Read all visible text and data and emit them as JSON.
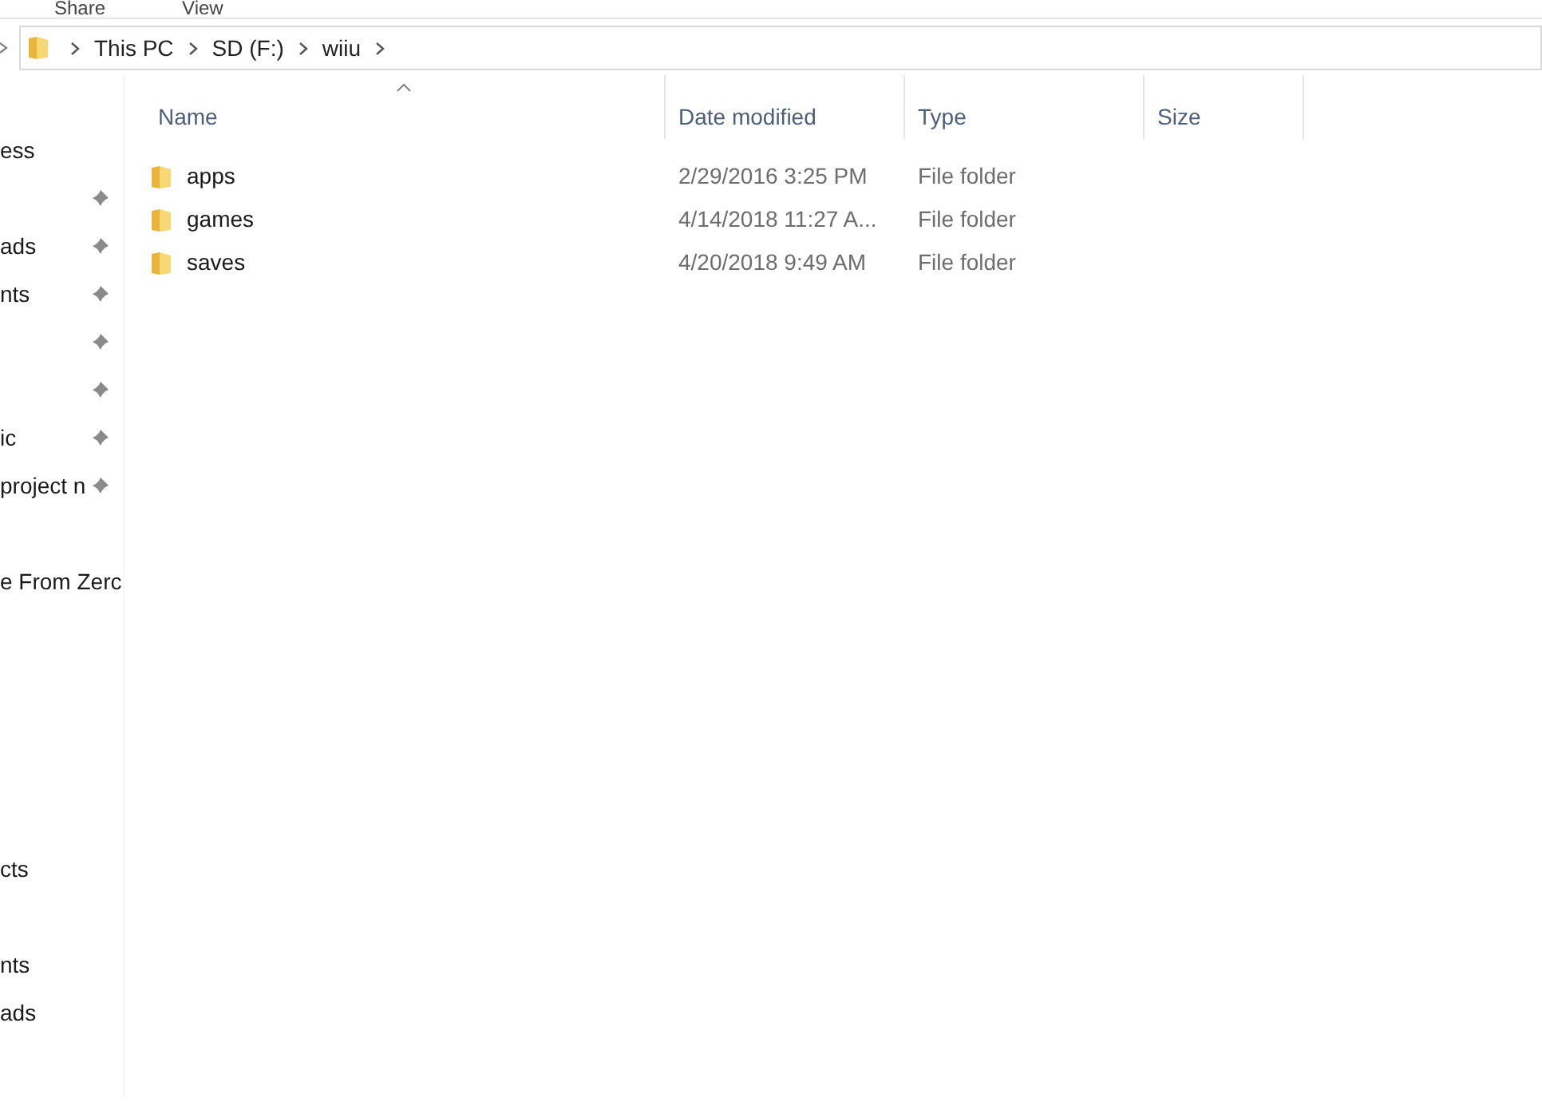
{
  "ribbon_tabs": [
    {
      "label": "Share"
    },
    {
      "label": "View"
    }
  ],
  "breadcrumb": [
    "This PC",
    "SD (F:)",
    "wiiu"
  ],
  "sidebar": {
    "groups": [
      {
        "items": [
          {
            "label": "ess",
            "pinned": false
          },
          {
            "pinned": true
          },
          {
            "label": "ads",
            "pinned": true
          },
          {
            "label": "nts",
            "pinned": true
          },
          {
            "pinned": true
          },
          {
            "pinned": true
          },
          {
            "label": "ic",
            "pinned": true
          },
          {
            "label": "project n",
            "pinned": true
          }
        ]
      },
      {
        "items": [
          {
            "label": "e From Zerc",
            "pinned": false
          }
        ]
      },
      {
        "items": [
          {
            "label": "cts",
            "pinned": false
          }
        ]
      },
      {
        "items": [
          {
            "label": "nts",
            "pinned": false
          },
          {
            "label": "ads",
            "pinned": false
          }
        ]
      }
    ]
  },
  "table": {
    "columns": [
      {
        "label": "Name",
        "sorted": true
      },
      {
        "label": "Date modified",
        "sorted": false
      },
      {
        "label": "Type",
        "sorted": false
      },
      {
        "label": "Size",
        "sorted": false
      }
    ],
    "rows": [
      {
        "name": "apps",
        "date": "2/29/2016 3:25 PM",
        "type": "File folder"
      },
      {
        "name": "games",
        "date": "4/14/2018 11:27 A...",
        "type": "File folder"
      },
      {
        "name": "saves",
        "date": "4/20/2018 9:49 AM",
        "type": "File folder"
      }
    ]
  }
}
